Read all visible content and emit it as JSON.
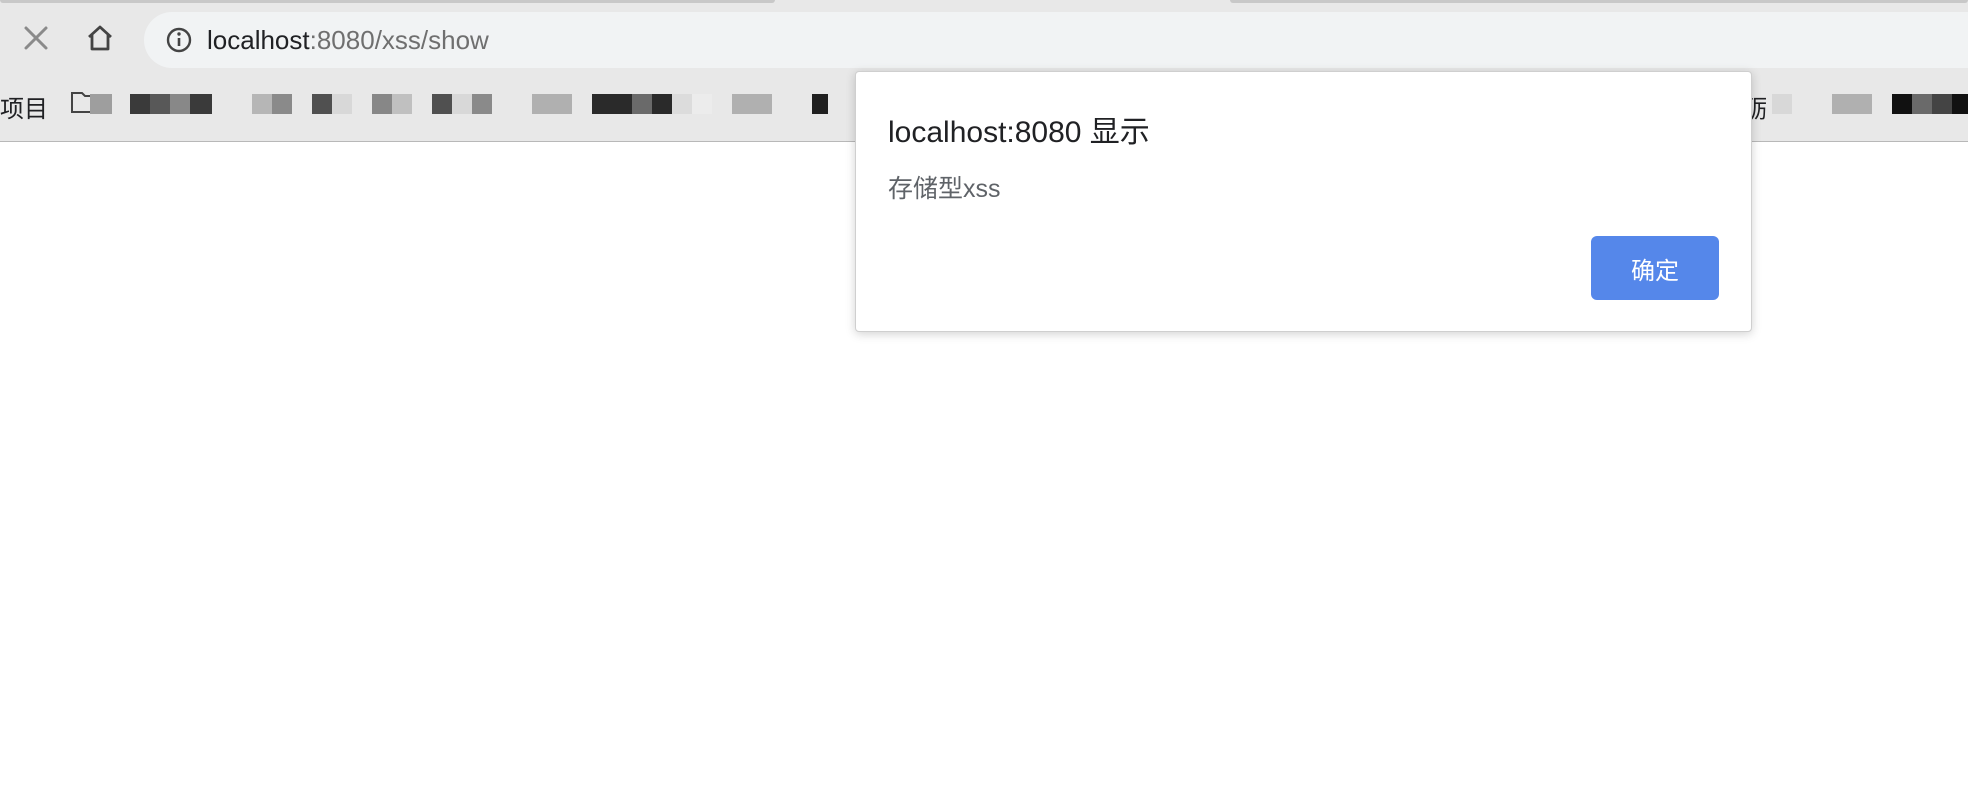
{
  "toolbar": {
    "stop_icon": "close-icon",
    "home_icon": "home-icon"
  },
  "omnibox": {
    "info_icon": "info-icon",
    "host": "localhost",
    "path": ":8080/xss/show"
  },
  "bookmarks": {
    "visible_label": "项目",
    "folder_icon": "folder-icon",
    "partial_label": "砺"
  },
  "dialog": {
    "title": "localhost:8080 显示",
    "message": "存储型xss",
    "ok_label": "确定",
    "ok_color": "#5587ea"
  }
}
